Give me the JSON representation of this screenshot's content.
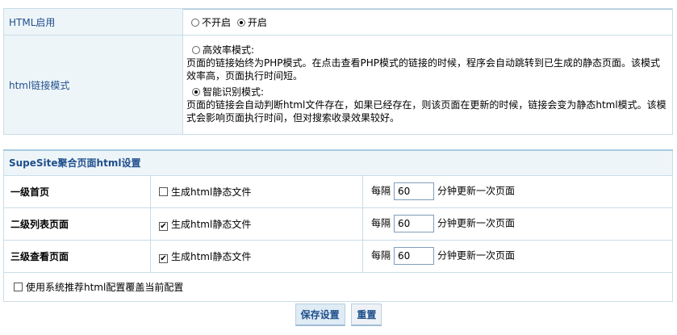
{
  "html_enable": {
    "label": "HTML启用",
    "option_off": "不开启",
    "option_on": "开启"
  },
  "link_mode": {
    "label": "html链接模式",
    "modes": [
      {
        "title": "高效率模式:",
        "desc1": "页面的链接始终为PHP模式。在点击查看PHP模式的链接的时候，程序会自动跳转到已生成的静态页面。该模式",
        "desc2": "效率高，页面执行时间短。"
      },
      {
        "title": "智能识别模式:",
        "desc1": "页面的链接会自动判断html文件存在，如果已经存在，则该页面在更新的时候，链接会变为静态html模式。该模",
        "desc2": "式会影响页面执行时间，但对搜索收录效果较好。"
      }
    ]
  },
  "supesite": {
    "title": "SupeSite聚合页面html设置",
    "rows": [
      {
        "name": "一级首页",
        "check_label": "生成html静态文件",
        "checked": false,
        "interval_prefix": "每隔",
        "interval": "60",
        "interval_suffix": "分钟更新一次页面"
      },
      {
        "name": "二级列表页面",
        "check_label": "生成html静态文件",
        "checked": true,
        "interval_prefix": "每隔",
        "interval": "60",
        "interval_suffix": "分钟更新一次页面"
      },
      {
        "name": "三级查看页面",
        "check_label": "生成html静态文件",
        "checked": true,
        "interval_prefix": "每隔",
        "interval": "60",
        "interval_suffix": "分钟更新一次页面"
      }
    ],
    "recommend_label": "使用系统推荐html配置覆盖当前配置"
  },
  "buttons": {
    "save": "保存设置",
    "reset": "重置"
  },
  "check_mark": "✔"
}
